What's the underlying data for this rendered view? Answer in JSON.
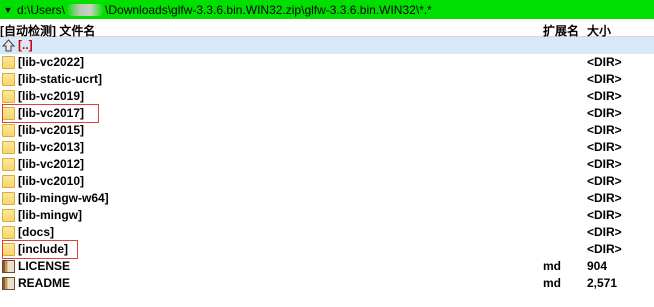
{
  "path_bar": {
    "dropdown_glyph": "▼",
    "path_before": "d:\\Users\\",
    "path_after": "\\Downloads\\glfw-3.3.6.bin.WIN32.zip\\glfw-3.3.6.bin.WIN32\\*.*",
    "background_color": "#00e000"
  },
  "columns": {
    "name": "[自动检测] 文件名",
    "ext": "扩展名",
    "size": "大小"
  },
  "rows": [
    {
      "name": "[..]",
      "ext": "",
      "size": "",
      "icon": "up-arrow-icon",
      "type": "parent"
    },
    {
      "name": "[lib-vc2022]",
      "ext": "",
      "size": "<DIR>",
      "icon": "folder-icon",
      "type": "dir"
    },
    {
      "name": "[lib-static-ucrt]",
      "ext": "",
      "size": "<DIR>",
      "icon": "folder-icon",
      "type": "dir"
    },
    {
      "name": "[lib-vc2019]",
      "ext": "",
      "size": "<DIR>",
      "icon": "folder-icon",
      "type": "dir"
    },
    {
      "name": "[lib-vc2017]",
      "ext": "",
      "size": "<DIR>",
      "icon": "folder-icon",
      "type": "dir",
      "highlighted": true
    },
    {
      "name": "[lib-vc2015]",
      "ext": "",
      "size": "<DIR>",
      "icon": "folder-icon",
      "type": "dir"
    },
    {
      "name": "[lib-vc2013]",
      "ext": "",
      "size": "<DIR>",
      "icon": "folder-icon",
      "type": "dir"
    },
    {
      "name": "[lib-vc2012]",
      "ext": "",
      "size": "<DIR>",
      "icon": "folder-icon",
      "type": "dir"
    },
    {
      "name": "[lib-vc2010]",
      "ext": "",
      "size": "<DIR>",
      "icon": "folder-icon",
      "type": "dir"
    },
    {
      "name": "[lib-mingw-w64]",
      "ext": "",
      "size": "<DIR>",
      "icon": "folder-icon",
      "type": "dir"
    },
    {
      "name": "[lib-mingw]",
      "ext": "",
      "size": "<DIR>",
      "icon": "folder-icon",
      "type": "dir"
    },
    {
      "name": "[docs]",
      "ext": "",
      "size": "<DIR>",
      "icon": "folder-icon",
      "type": "dir"
    },
    {
      "name": "[include]",
      "ext": "",
      "size": "<DIR>",
      "icon": "folder-icon",
      "type": "dir",
      "highlighted": true
    },
    {
      "name": "LICENSE",
      "ext": "md",
      "size": "904",
      "icon": "archive-file-icon",
      "type": "file"
    },
    {
      "name": "README",
      "ext": "md",
      "size": "2,571",
      "icon": "archive-file-icon",
      "type": "file"
    }
  ],
  "colors": {
    "parent_row_bg": "#d8e8f8",
    "parent_name": "#d00000",
    "highlight_box": "#e04040"
  }
}
